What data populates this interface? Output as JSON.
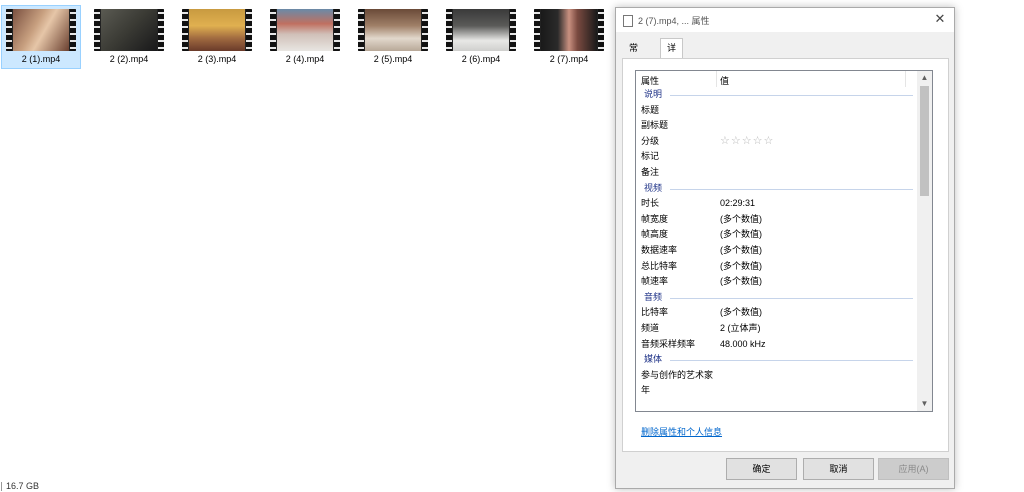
{
  "explorer": {
    "files": [
      {
        "name": "2 (1).mp4",
        "selected": true
      },
      {
        "name": "2 (2).mp4",
        "selected": false
      },
      {
        "name": "2 (3).mp4",
        "selected": false
      },
      {
        "name": "2 (4).mp4",
        "selected": false
      },
      {
        "name": "2 (5).mp4",
        "selected": false
      },
      {
        "name": "2 (6).mp4",
        "selected": false
      },
      {
        "name": "2 (7).mp4",
        "selected": false
      }
    ],
    "status_size": "16.7 GB"
  },
  "dialog": {
    "title": "2 (7).mp4, ... 属性",
    "tabs": [
      "常规",
      "详细信息"
    ],
    "active_tab": "详细信息",
    "columns": {
      "property": "属性",
      "value": "值"
    },
    "sections": {
      "description": "说明",
      "video": "视频",
      "audio": "音频",
      "media": "媒体"
    },
    "props": {
      "title": {
        "k": "标题",
        "v": ""
      },
      "subtitle": {
        "k": "副标题",
        "v": ""
      },
      "rating": {
        "k": "分级",
        "v": "☆☆☆☆☆"
      },
      "tags": {
        "k": "标记",
        "v": ""
      },
      "comments": {
        "k": "备注",
        "v": ""
      },
      "length": {
        "k": "时长",
        "v": "02:29:31"
      },
      "frame_width": {
        "k": "帧宽度",
        "v": "(多个数值)"
      },
      "frame_height": {
        "k": "帧高度",
        "v": "(多个数值)"
      },
      "data_rate": {
        "k": "数据速率",
        "v": "(多个数值)"
      },
      "total_bitrate": {
        "k": "总比特率",
        "v": "(多个数值)"
      },
      "frame_rate": {
        "k": "帧速率",
        "v": "(多个数值)"
      },
      "audio_bitrate": {
        "k": "比特率",
        "v": "(多个数值)"
      },
      "channels": {
        "k": "频道",
        "v": "2 (立体声)"
      },
      "sample_rate": {
        "k": "音频采样频率",
        "v": "48.000 kHz"
      },
      "contributing_artists": {
        "k": "参与创作的艺术家",
        "v": ""
      },
      "year": {
        "k": "年",
        "v": ""
      }
    },
    "remove_link": "删除属性和个人信息",
    "buttons": {
      "ok": "确定",
      "cancel": "取消",
      "apply": "应用(A)"
    },
    "icons": {
      "close": "close-icon",
      "scroll_up": "scroll-up-icon",
      "scroll_down": "scroll-down-icon"
    }
  },
  "colors": {
    "selection": "#cce8ff",
    "group_header": "#1e3287",
    "link": "#0066cc"
  }
}
